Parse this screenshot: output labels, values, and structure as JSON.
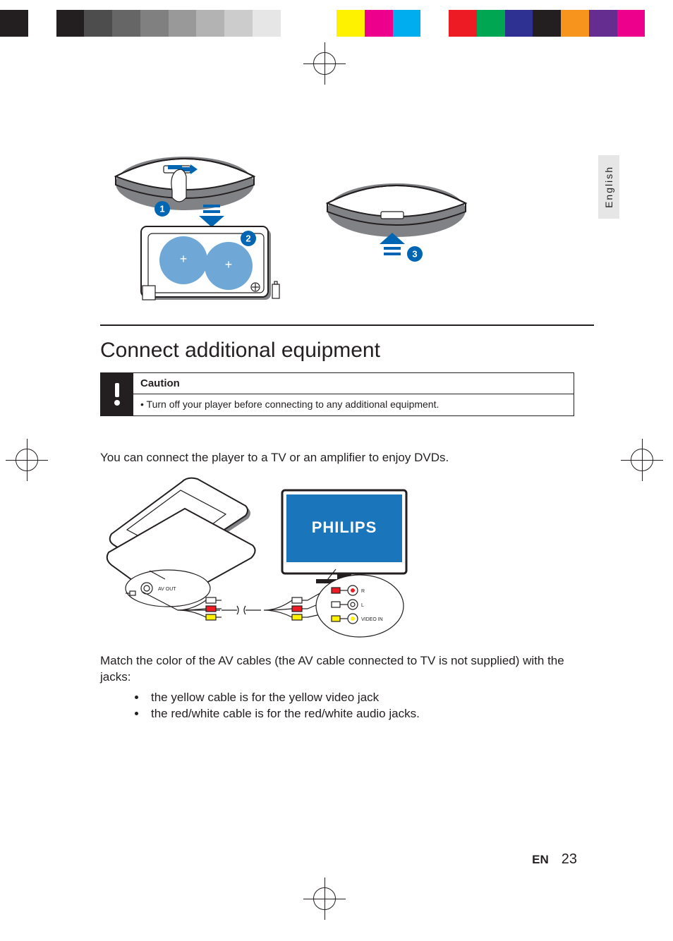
{
  "colorbar": [
    "#231f20",
    "#ffffff",
    "#231f20",
    "#4d4d4d",
    "#666666",
    "#808080",
    "#999999",
    "#b3b3b3",
    "#cccccc",
    "#e6e6e6",
    "#ffffff",
    "#ffffff",
    "#fff200",
    "#ec008c",
    "#00aeef",
    "#ffffff",
    "#ed1c24",
    "#00a651",
    "#2e3192",
    "#231f20",
    "#f7941d",
    "#662d91",
    "#ec008c",
    "#ffffff"
  ],
  "language_tab": "English",
  "heading": "Connect additional equipment",
  "caution": {
    "title": "Caution",
    "body": "Turn off your player before connecting to any additional equipment."
  },
  "paragraph1": "You can connect the player to a TV or an amplifier to enjoy DVDs.",
  "paragraph2": "Match the color of the AV cables (the AV cable connected to TV is not supplied) with the jacks:",
  "bullets": [
    "the yellow cable is for the yellow video jack",
    "the red/white cable is for the red/white audio jacks."
  ],
  "footer": {
    "lang_code": "EN",
    "page_num": "23"
  },
  "diagram1": {
    "steps": [
      "1",
      "2",
      "3"
    ],
    "remote_labels": [
      "+",
      "+"
    ]
  },
  "diagram2": {
    "tv_brand": "PHILIPS",
    "av_out_label": "AV OUT",
    "jack_labels": {
      "r": "R",
      "l": "L",
      "video": "VIDEO IN"
    }
  }
}
